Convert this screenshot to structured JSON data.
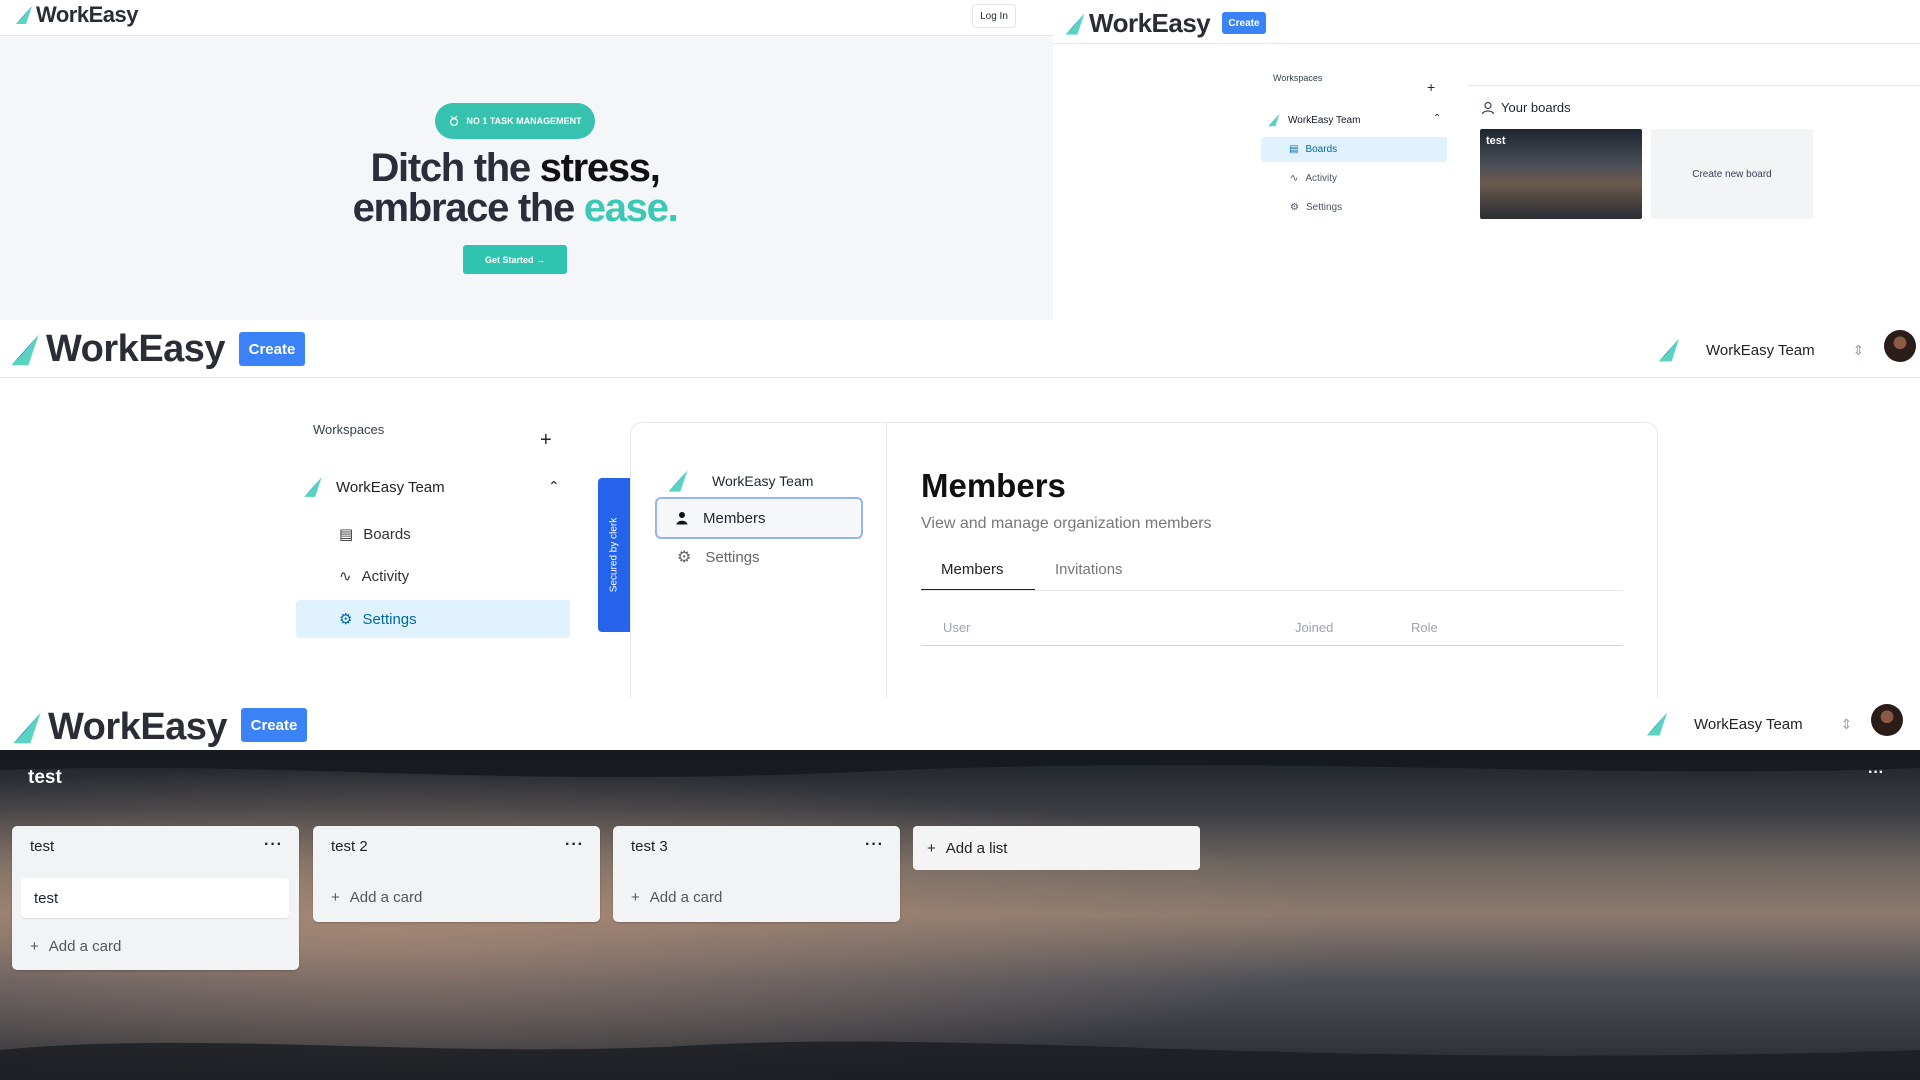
{
  "brand": {
    "name": "WorkEasy",
    "create_label": "Create",
    "accent": "#3b82f6",
    "teal": "#2ec4b0"
  },
  "landing": {
    "login_label": "Log In",
    "badge": "NO 1 TASK MANAGEMENT",
    "headline_line1_a": "Ditch the ",
    "headline_line1_b": "stress,",
    "headline_line2_a": "embrace the ",
    "headline_line2_b": "ease.",
    "cta": "Get Started →"
  },
  "boards": {
    "workspaces_label": "Workspaces",
    "team_name": "WorkEasy Team",
    "nav": [
      {
        "label": "Boards",
        "icon": "layout-icon",
        "active": true
      },
      {
        "label": "Activity",
        "icon": "activity-icon"
      },
      {
        "label": "Settings",
        "icon": "gear-icon"
      }
    ],
    "your_boards_label": "Your boards",
    "board_title": "test",
    "create_new_board": "Create new board"
  },
  "members": {
    "workspaces_label": "Workspaces",
    "team_name": "WorkEasy Team",
    "nav": [
      {
        "label": "Boards",
        "icon": "layout-icon"
      },
      {
        "label": "Activity",
        "icon": "activity-icon"
      },
      {
        "label": "Settings",
        "icon": "gear-icon",
        "active": true
      }
    ],
    "clerk_label": "Secured by  clerk",
    "org_name": "WorkEasy Team",
    "org_nav": [
      {
        "label": "Members",
        "icon": "user-icon",
        "active": true
      },
      {
        "label": "Settings",
        "icon": "gear-icon"
      }
    ],
    "title": "Members",
    "subtitle": "View and manage organization members",
    "tabs": [
      "Members",
      "Invitations"
    ],
    "columns": [
      "User",
      "Joined",
      "Role"
    ]
  },
  "header": {
    "team_name": "WorkEasy Team"
  },
  "boardview": {
    "board_title": "test",
    "lists": [
      {
        "title": "test",
        "cards": [
          "test"
        ],
        "add_card": "Add a card"
      },
      {
        "title": "test 2",
        "cards": [],
        "add_card": "Add a card"
      },
      {
        "title": "test 3",
        "cards": [],
        "add_card": "Add a card"
      }
    ],
    "add_list": "Add a list"
  }
}
